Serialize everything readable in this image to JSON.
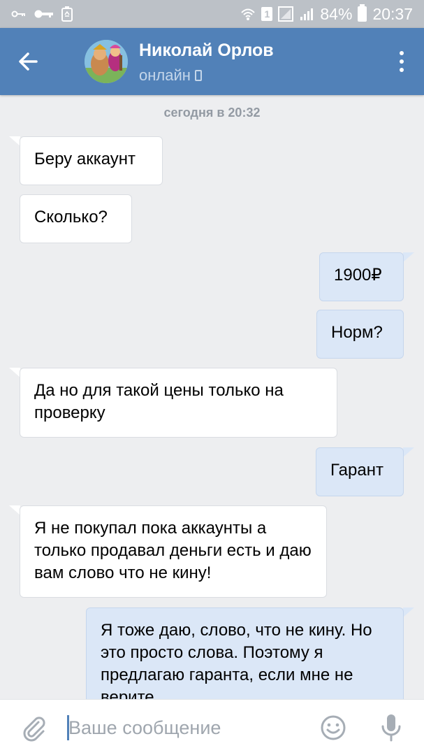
{
  "status_bar": {
    "battery": "84%",
    "time": "20:37",
    "sim": "1"
  },
  "header": {
    "back_icon": "arrow-left-icon",
    "name": "Николай Орлов",
    "status": "онлайн",
    "status_icon": "phone-icon",
    "menu_icon": "more-vertical-icon"
  },
  "chat": {
    "date_separator": "сегодня в 20:32",
    "messages": [
      {
        "direction": "in",
        "text": "Беру аккаунт"
      },
      {
        "direction": "in",
        "text": "Сколько?"
      },
      {
        "direction": "out",
        "text": "1900₽"
      },
      {
        "direction": "out",
        "text": "Норм?"
      },
      {
        "direction": "in",
        "text": "Да но для такой цены только на проверку"
      },
      {
        "direction": "out",
        "text": "Гарант"
      },
      {
        "direction": "in",
        "text": "Я не покупал пока аккаунты а только продавал деньги есть и даю вам слово что не кину!"
      },
      {
        "direction": "out",
        "text": "Я тоже даю, слово, что не кину. Но это просто слова. Поэтому я предлагаю гаранта, если мне не верите"
      }
    ]
  },
  "input": {
    "placeholder": "Ваше сообщение",
    "value": "",
    "attach_icon": "paperclip-icon",
    "emoji_icon": "smiley-icon",
    "mic_icon": "microphone-icon"
  },
  "colors": {
    "header": "#5181b8",
    "background": "#edeef0",
    "incoming_bubble": "#ffffff",
    "outgoing_bubble": "#dbe7f7",
    "status_bar": "#bcc1c7"
  }
}
